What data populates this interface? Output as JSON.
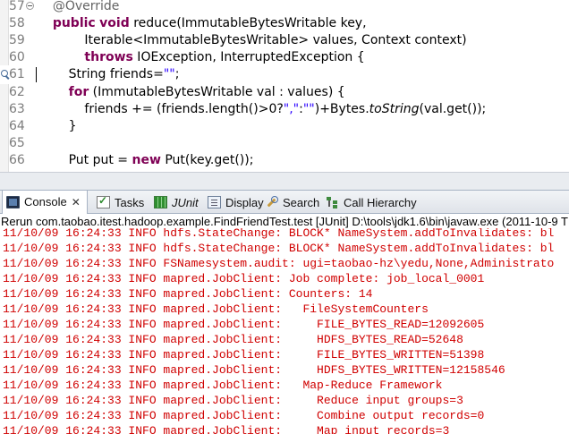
{
  "editor": {
    "lines": [
      {
        "num": "57",
        "fold": true,
        "segments": [
          {
            "t": "    "
          },
          {
            "t": "@Override",
            "c": "ann"
          }
        ]
      },
      {
        "num": "58",
        "fold": false,
        "segments": [
          {
            "t": "    "
          },
          {
            "t": "public",
            "c": "kw"
          },
          {
            "t": " "
          },
          {
            "t": "void",
            "c": "kw"
          },
          {
            "t": " reduce(ImmutableBytesWritable key,"
          }
        ]
      },
      {
        "num": "59",
        "fold": false,
        "segments": [
          {
            "t": "            Iterable<ImmutableBytesWritable> values, Context context)"
          }
        ]
      },
      {
        "num": "60",
        "fold": false,
        "segments": [
          {
            "t": "            "
          },
          {
            "t": "throws",
            "c": "kw"
          },
          {
            "t": " IOException, InterruptedException {"
          }
        ]
      },
      {
        "num": "61",
        "fold": false,
        "mark": true,
        "current": true,
        "segments": [
          {
            "t": "        String friends="
          },
          {
            "t": "\"\"",
            "c": "str"
          },
          {
            "t": ";"
          }
        ]
      },
      {
        "num": "62",
        "fold": false,
        "segments": [
          {
            "t": "        "
          },
          {
            "t": "for",
            "c": "kw"
          },
          {
            "t": " (ImmutableBytesWritable val : values) {"
          }
        ]
      },
      {
        "num": "63",
        "fold": false,
        "segments": [
          {
            "t": "            friends += (friends.length()>0?"
          },
          {
            "t": "\",\"",
            "c": "str"
          },
          {
            "t": ":"
          },
          {
            "t": "\"\"",
            "c": "str"
          },
          {
            "t": ")+Bytes."
          },
          {
            "t": "toString",
            "c": "it"
          },
          {
            "t": "(val.get());"
          }
        ]
      },
      {
        "num": "64",
        "fold": false,
        "segments": [
          {
            "t": "        }"
          }
        ]
      },
      {
        "num": "65",
        "fold": false,
        "segments": [
          {
            "t": ""
          }
        ]
      },
      {
        "num": "66",
        "fold": false,
        "segments": [
          {
            "t": "        Put put = "
          },
          {
            "t": "new",
            "c": "kw"
          },
          {
            "t": " Put(key.get());"
          }
        ]
      }
    ]
  },
  "tabs": [
    {
      "label": "Console",
      "icon": "console-icon",
      "close": "✕",
      "active": true
    },
    {
      "label": "Tasks",
      "icon": "tasks-icon"
    },
    {
      "label": "JUnit",
      "icon": "junit-icon"
    },
    {
      "label": "Display",
      "icon": "display-icon"
    },
    {
      "label": "Search",
      "icon": "search-icon"
    },
    {
      "label": "Call Hierarchy",
      "icon": "hierarchy-icon"
    }
  ],
  "console": {
    "header": "Rerun com.taobao.itest.hadoop.example.FindFriendTest.test [JUnit] D:\\tools\\jdk1.6\\bin\\javaw.exe (2011-10-9 T",
    "lines": [
      "11/10/09 16:24:33 INFO hdfs.StateChange: BLOCK* NameSystem.addToInvalidates: bl",
      "11/10/09 16:24:33 INFO hdfs.StateChange: BLOCK* NameSystem.addToInvalidates: bl",
      "11/10/09 16:24:33 INFO FSNamesystem.audit: ugi=taobao-hz\\yedu,None,Administrato",
      "11/10/09 16:24:33 INFO mapred.JobClient: Job complete: job_local_0001",
      "11/10/09 16:24:33 INFO mapred.JobClient: Counters: 14",
      "11/10/09 16:24:33 INFO mapred.JobClient:   FileSystemCounters",
      "11/10/09 16:24:33 INFO mapred.JobClient:     FILE_BYTES_READ=12092605",
      "11/10/09 16:24:33 INFO mapred.JobClient:     HDFS_BYTES_READ=52648",
      "11/10/09 16:24:33 INFO mapred.JobClient:     FILE_BYTES_WRITTEN=51398",
      "11/10/09 16:24:33 INFO mapred.JobClient:     HDFS_BYTES_WRITTEN=12158546",
      "11/10/09 16:24:33 INFO mapred.JobClient:   Map-Reduce Framework",
      "11/10/09 16:24:33 INFO mapred.JobClient:     Reduce input groups=3",
      "11/10/09 16:24:33 INFO mapred.JobClient:     Combine output records=0",
      "11/10/09 16:24:33 INFO mapred.JobClient:     Map input records=3"
    ]
  },
  "colors": {
    "keyword": "#7f0055",
    "string": "#2a00ff",
    "annotation": "#646464",
    "console_text": "#d00000"
  }
}
